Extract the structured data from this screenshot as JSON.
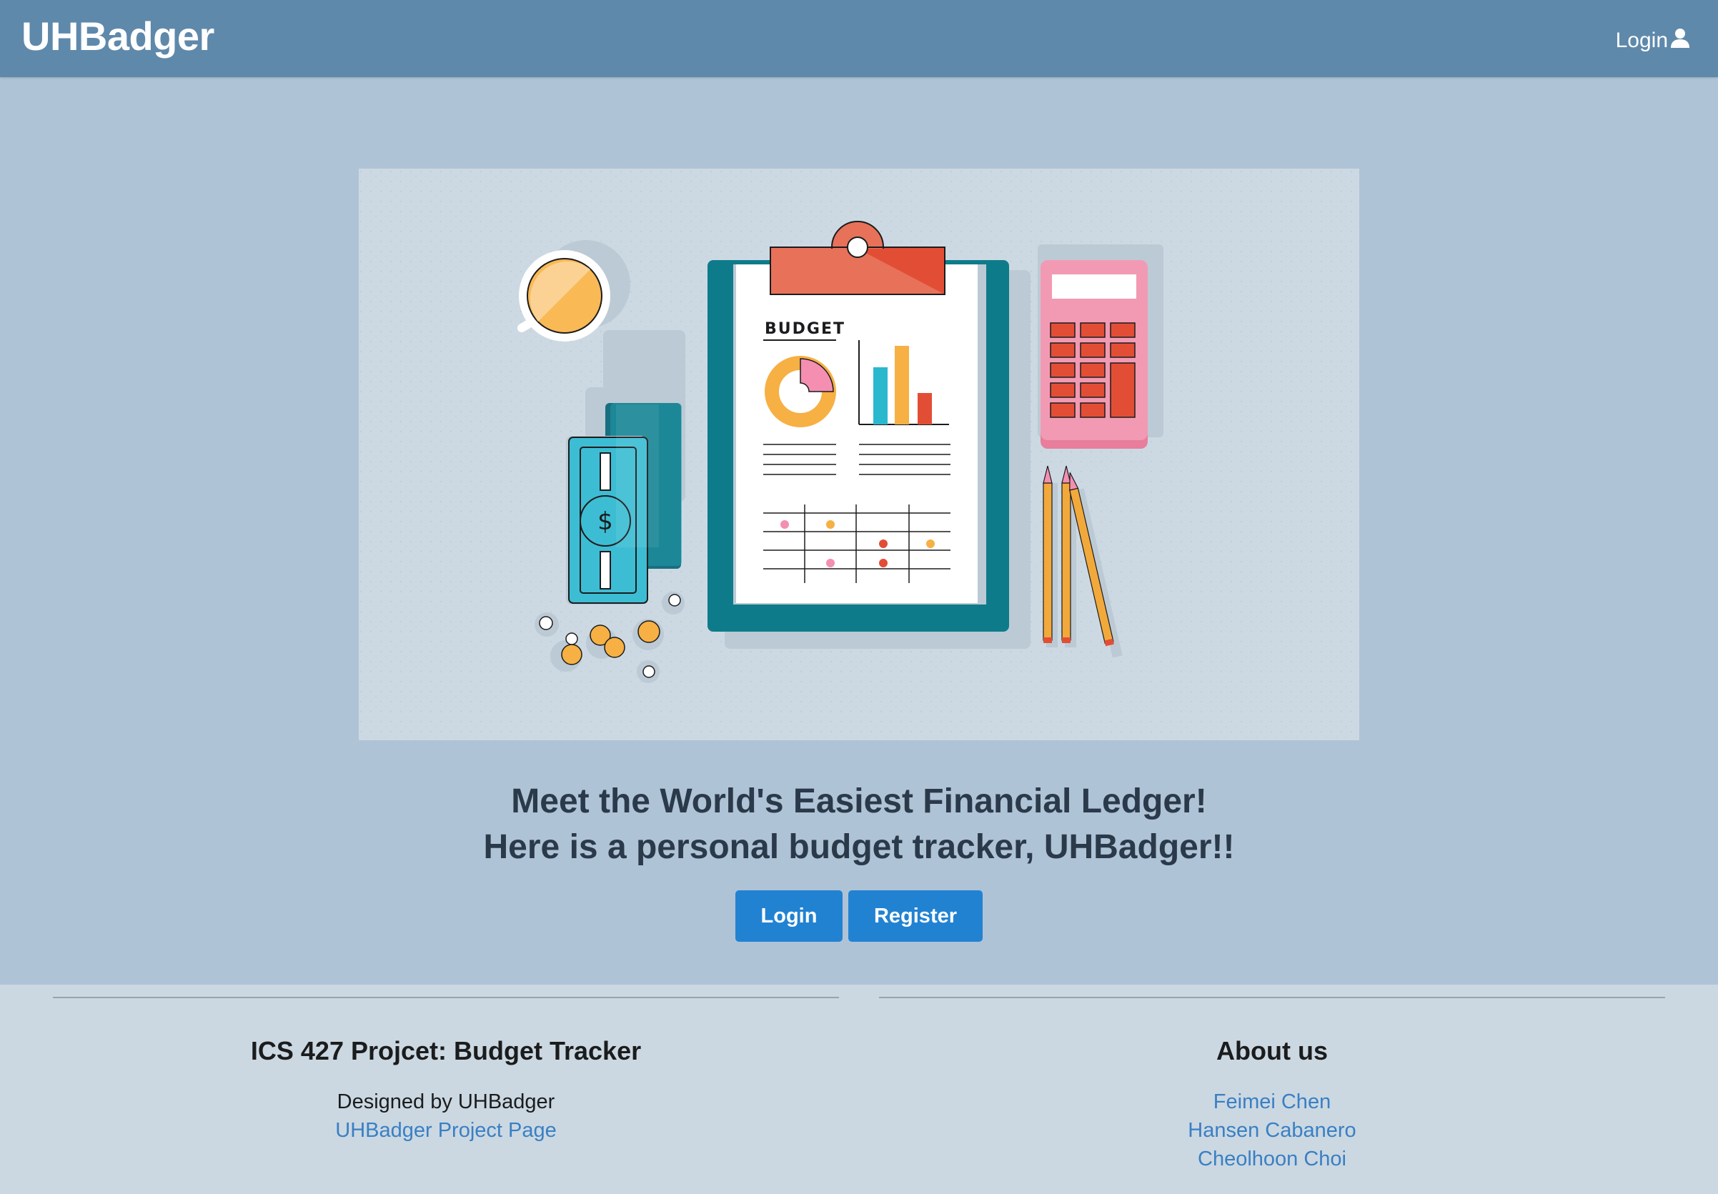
{
  "header": {
    "brand": "UHBadger",
    "login_label": "Login"
  },
  "hero": {
    "illustration_label": "BUDGET",
    "headline_1": "Meet the World's Easiest Financial Ledger!",
    "headline_2": "Here is a personal budget tracker, UHBadger!!",
    "login_button": "Login",
    "register_button": "Register"
  },
  "footer": {
    "left": {
      "title": "ICS 427 Projcet: Budget Tracker",
      "designed_by": "Designed by UHBadger",
      "project_link": "UHBadger Project Page"
    },
    "right": {
      "title": "About us",
      "members": [
        "Feimei Chen",
        "Hansen Cabanero",
        "Cheolhoon Choi"
      ]
    }
  },
  "colors": {
    "navbar": "#5f89ab",
    "background": "#afc3d6",
    "button": "#2282d2",
    "footer": "#cbd8e1",
    "link": "#3a7fc4"
  },
  "icons": {
    "nav_login": "user-icon"
  }
}
